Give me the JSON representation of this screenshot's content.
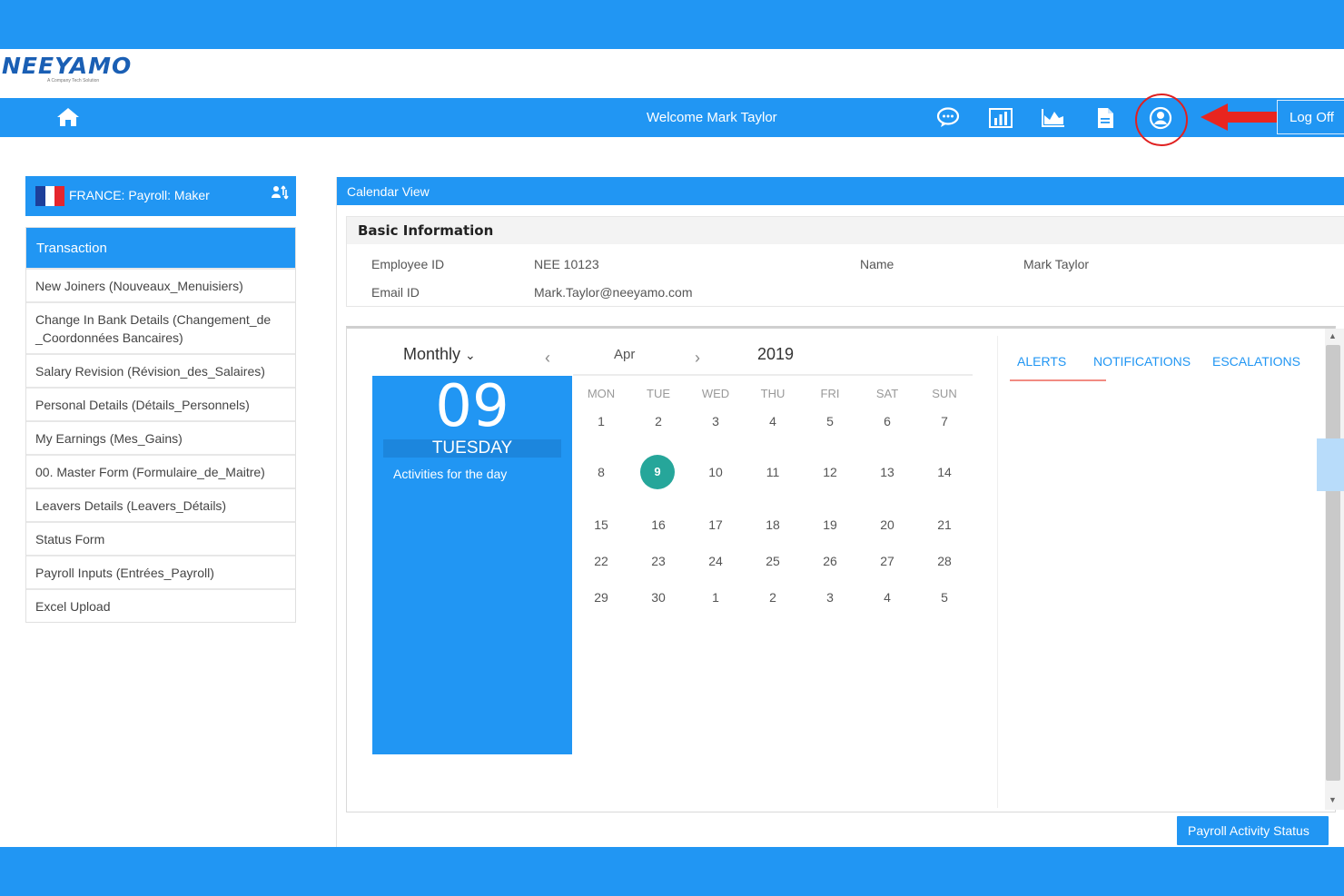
{
  "brand": {
    "logo_text": "NEEYAMO",
    "logo_subtitle": "A Company Tech Solution",
    "colors": {
      "primary": "#2196f3",
      "today": "#26a69a",
      "highlight": "#e02020"
    }
  },
  "navbar": {
    "welcome": "Welcome Mark Taylor",
    "icons": [
      "home-icon",
      "chat-icon",
      "bar-chart-icon",
      "area-chart-icon",
      "document-icon",
      "user-circle-icon"
    ],
    "logoff_label": "Log Off"
  },
  "role": {
    "label": "FRANCE: Payroll: Maker",
    "flag": "france-flag",
    "icon": "switch-role-icon"
  },
  "sidebar": {
    "heading": "Transaction",
    "items": [
      "New Joiners (Nouveaux_Menuisiers)",
      "Change In Bank Details (Changement_de _Coordonnées Bancaires)",
      "Salary Revision (Révision_des_Salaires)",
      "Personal Details (Détails_Personnels)",
      "My Earnings (Mes_Gains)",
      "00. Master Form (Formulaire_de_Maitre)",
      "Leavers Details (Leavers_Détails)",
      "Status Form",
      "Payroll Inputs (Entrées_Payroll)",
      "Excel Upload"
    ]
  },
  "panel": {
    "title": "Calendar View",
    "basic_info": {
      "title": "Basic Information",
      "employee_id_label": "Employee ID",
      "employee_id": "NEE 10123",
      "email_label": "Email ID",
      "email": "Mark.Taylor@neeyamo.com",
      "name_label": "Name",
      "name": "Mark Taylor"
    }
  },
  "calendar": {
    "view": "Monthly",
    "month": "Apr",
    "year": "2019",
    "selected_day_num": "09",
    "selected_day_name": "TUESDAY",
    "activities_label": "Activities for the day",
    "weekdays": [
      "MON",
      "TUE",
      "WED",
      "THU",
      "FRI",
      "SAT",
      "SUN"
    ],
    "weeks": [
      [
        "1",
        "2",
        "3",
        "4",
        "5",
        "6",
        "7"
      ],
      [
        "8",
        "9",
        "10",
        "11",
        "12",
        "13",
        "14"
      ],
      [
        "15",
        "16",
        "17",
        "18",
        "19",
        "20",
        "21"
      ],
      [
        "22",
        "23",
        "24",
        "25",
        "26",
        "27",
        "28"
      ],
      [
        "29",
        "30",
        "1",
        "2",
        "3",
        "4",
        "5"
      ]
    ],
    "today": "9"
  },
  "tabs": [
    "ALERTS",
    "NOTIFICATIONS",
    "ESCALATIONS"
  ],
  "active_tab": "ALERTS",
  "footer_button": "Payroll Activity Status"
}
